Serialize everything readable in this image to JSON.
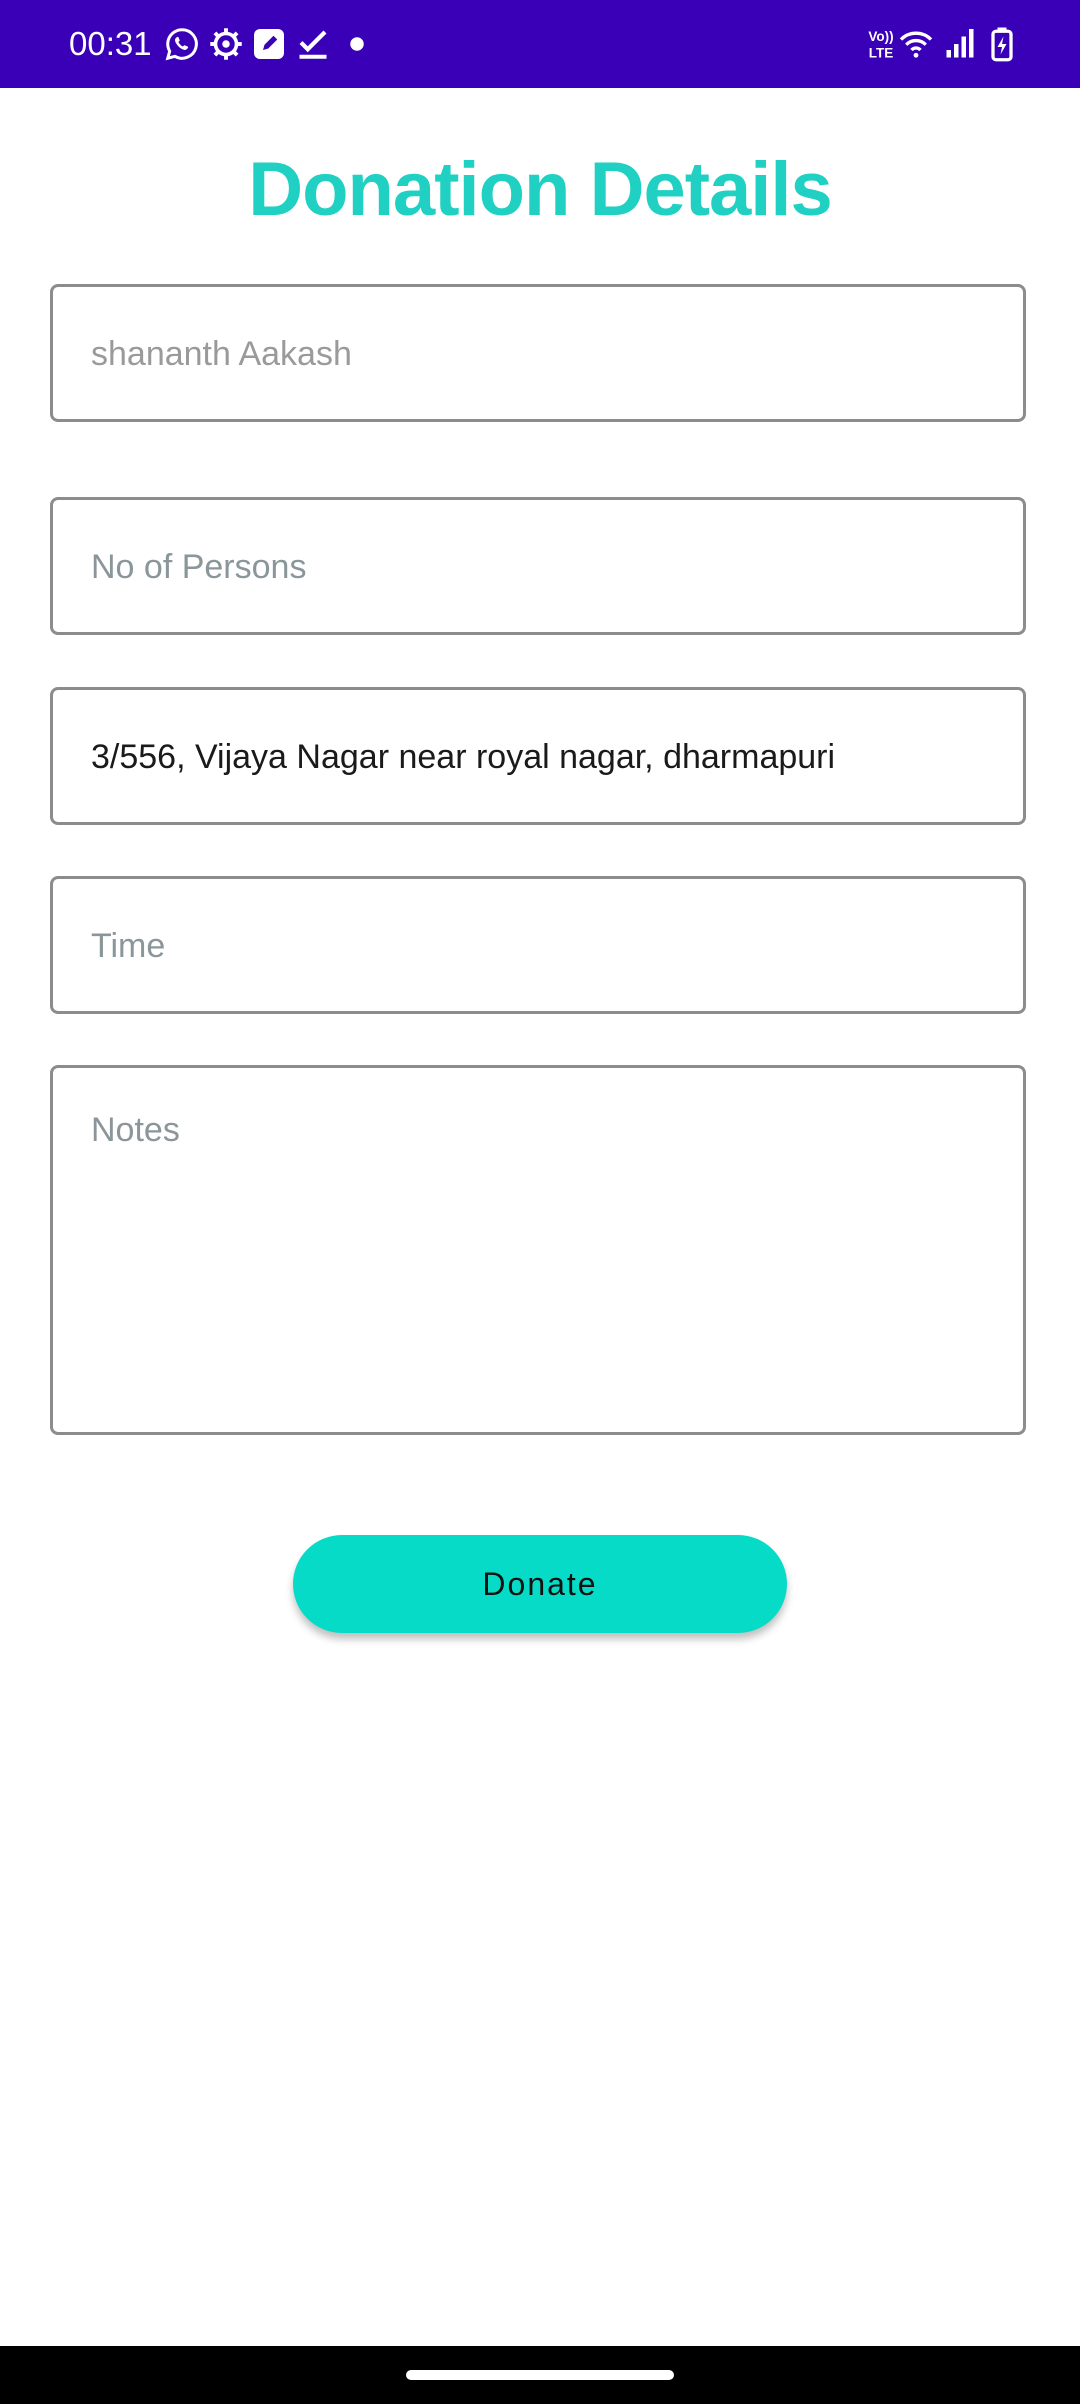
{
  "status_bar": {
    "time": "00:31",
    "bg_color": "#3a00b8",
    "notification_icons": [
      "whatsapp-icon",
      "settings-gear-icon",
      "edit-app-icon",
      "checkmark-icon",
      "dot-icon"
    ],
    "system_icons": [
      "volte-icon",
      "wifi-icon",
      "signal-icon",
      "battery-charging-icon"
    ],
    "volte_label_top": "Vo))",
    "volte_label_bottom": "LTE"
  },
  "title": "Donation Details",
  "form": {
    "name_value": "shananth Aakash",
    "persons_placeholder": "No of Persons",
    "address_value": "3/556, Vijaya Nagar near royal nagar, dharmapuri",
    "time_placeholder": "Time",
    "notes_placeholder": "Notes"
  },
  "donate_label": "Donate",
  "colors": {
    "accent": "#1fd0c3",
    "button": "#05dbc6",
    "field_border": "#8c8c8c"
  }
}
